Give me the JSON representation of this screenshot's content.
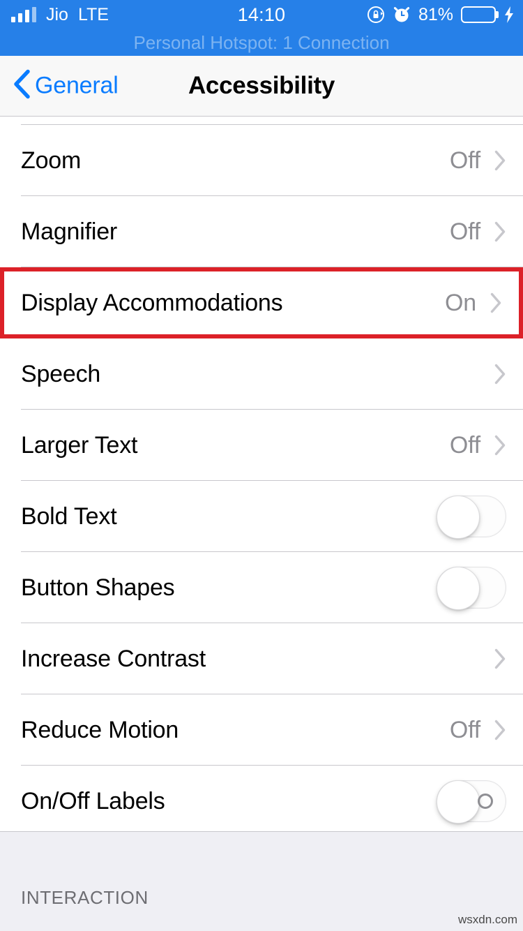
{
  "status_bar": {
    "carrier": "Jio",
    "network": "LTE",
    "time": "14:10",
    "battery_percent": "81%",
    "battery_level": 81,
    "icons": [
      "signal-bars-icon",
      "rotation-lock-icon",
      "alarm-clock-icon",
      "battery-icon",
      "charging-bolt-icon"
    ],
    "background_color": "#2680e8",
    "hotspot_banner": "Personal Hotspot: 1 Connection"
  },
  "nav_bar": {
    "back_label": "General",
    "title": "Accessibility",
    "tint_color": "#0a7cff"
  },
  "highlight": {
    "color": "#dc2128",
    "target_row": "Display Accommodations"
  },
  "rows": [
    {
      "label": "Zoom",
      "value": "Off",
      "control": "chevron"
    },
    {
      "label": "Magnifier",
      "value": "Off",
      "control": "chevron"
    },
    {
      "label": "Display Accommodations",
      "value": "On",
      "control": "chevron",
      "highlighted": true
    },
    {
      "label": "Speech",
      "value": "",
      "control": "chevron"
    },
    {
      "label": "Larger Text",
      "value": "Off",
      "control": "chevron"
    },
    {
      "label": "Bold Text",
      "value": "",
      "control": "toggle",
      "toggle_on": false
    },
    {
      "label": "Button Shapes",
      "value": "",
      "control": "toggle",
      "toggle_on": false
    },
    {
      "label": "Increase Contrast",
      "value": "",
      "control": "chevron"
    },
    {
      "label": "Reduce Motion",
      "value": "Off",
      "control": "chevron"
    },
    {
      "label": "On/Off Labels",
      "value": "",
      "control": "toggle",
      "toggle_on": false,
      "show_off_mark": true
    }
  ],
  "footer": {
    "section_header": "INTERACTION"
  },
  "watermark": "wsxdn.com"
}
